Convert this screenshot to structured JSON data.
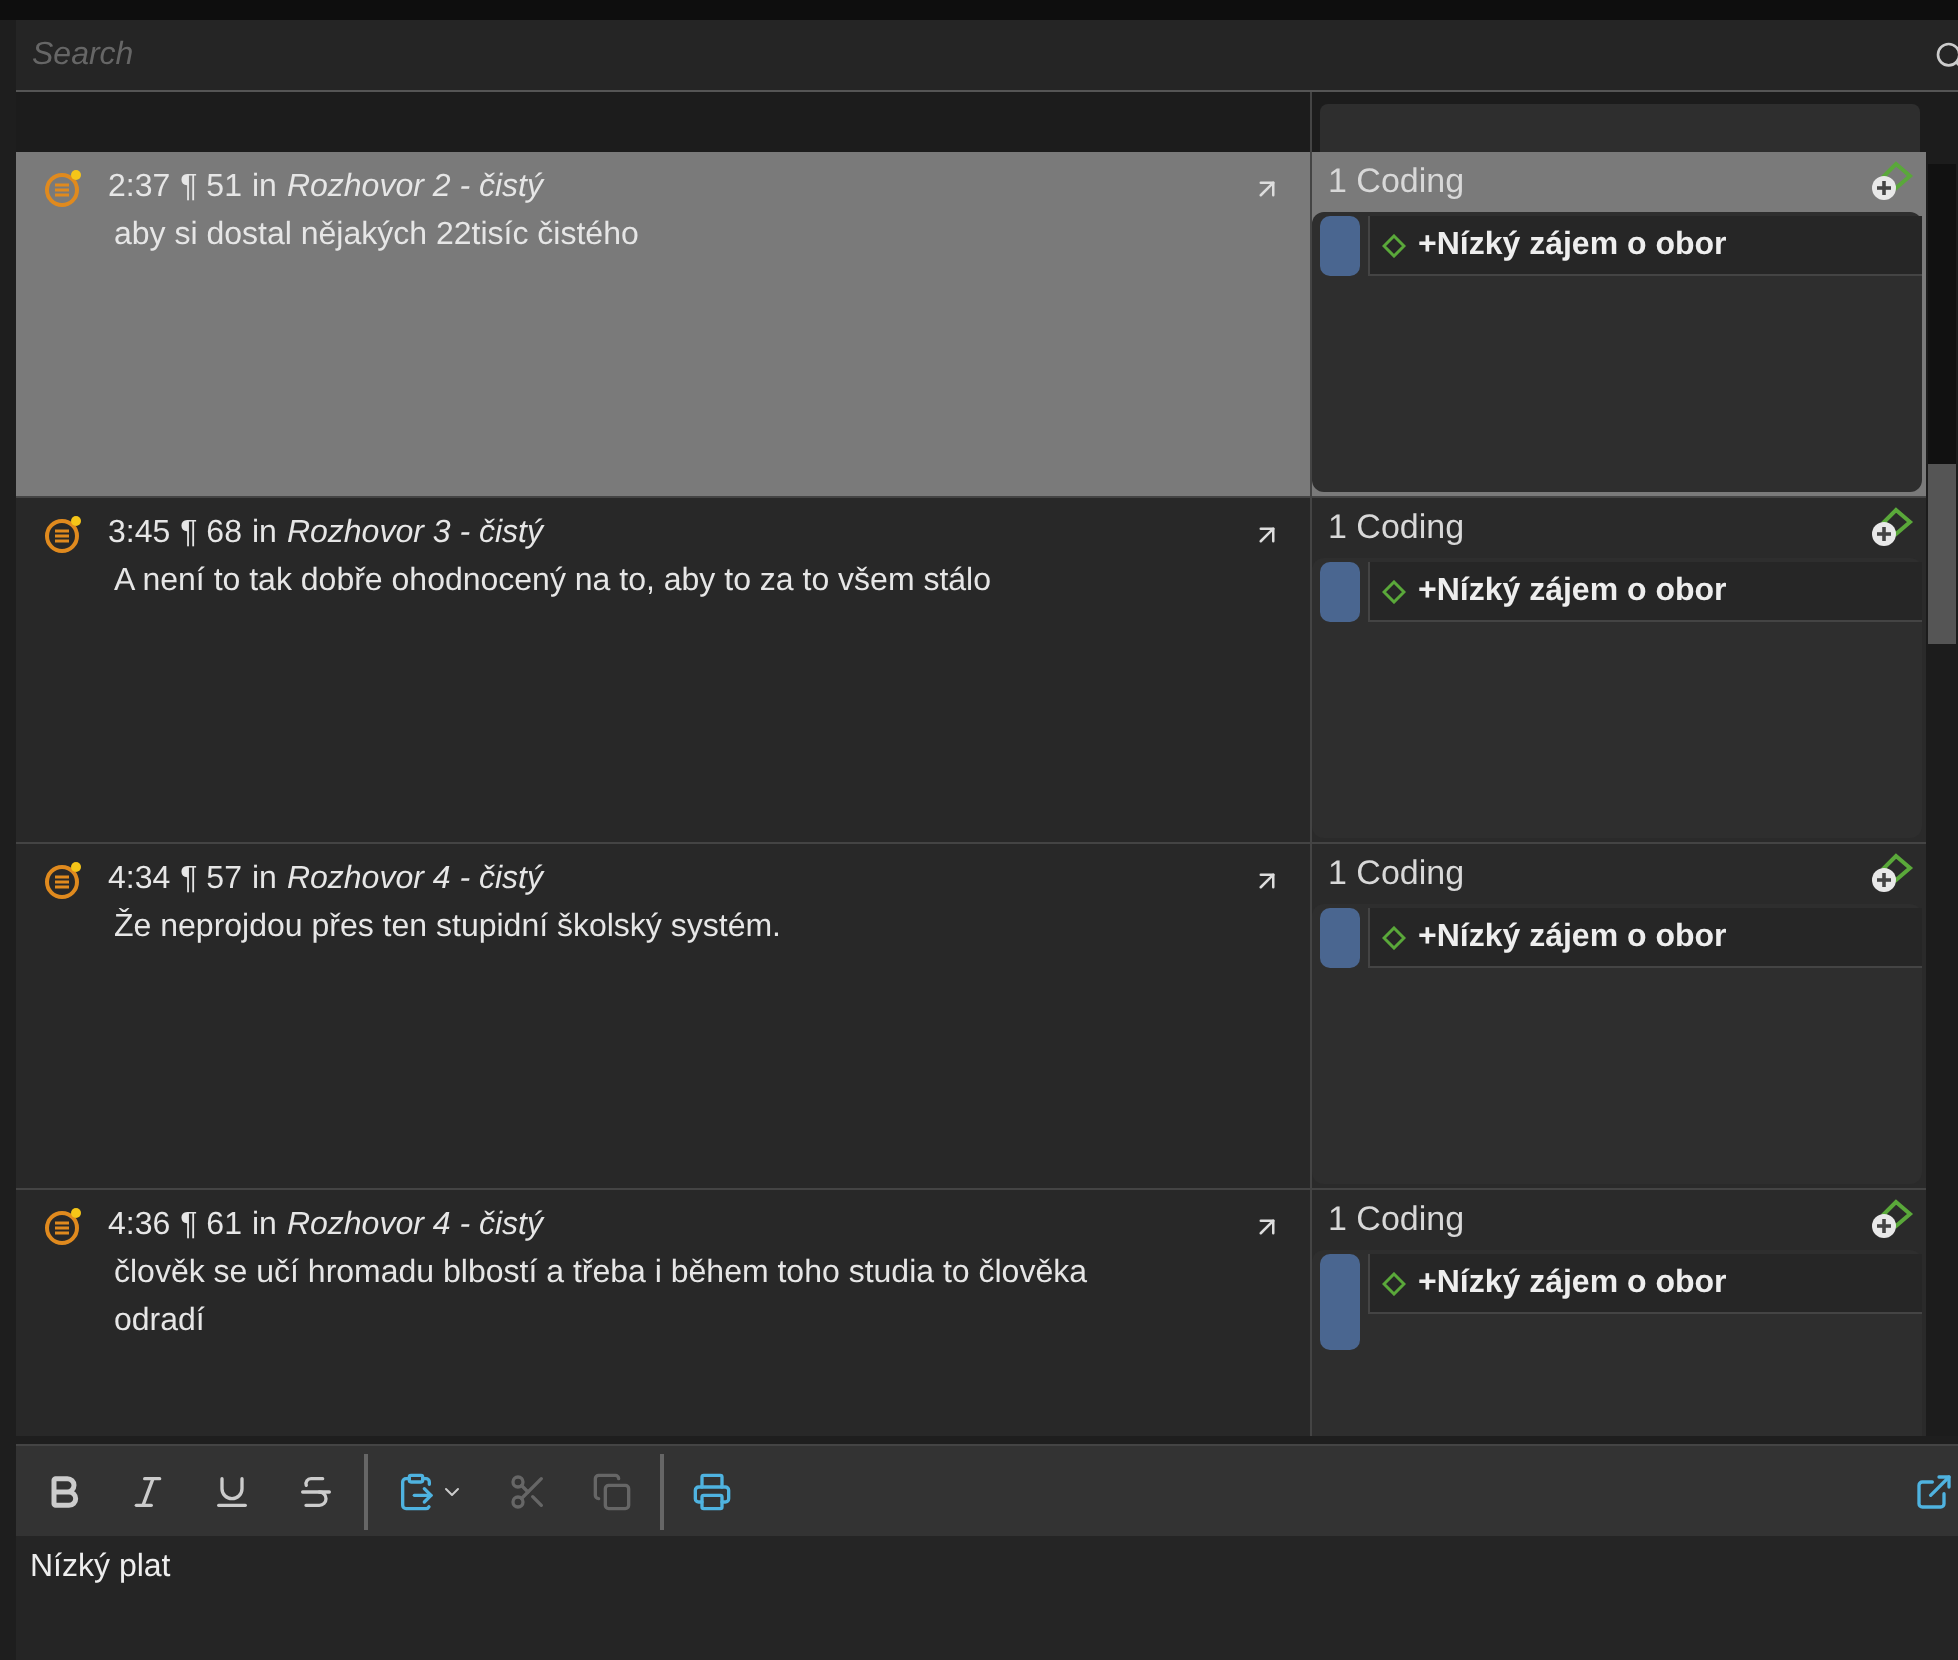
{
  "search": {
    "placeholder": "Search"
  },
  "quotations": [
    {
      "id": "2:37",
      "paragraph": "¶ 51",
      "in": "in",
      "document": "Rozhovor 2 - čistý",
      "text": "aby si dostal nějakých 22tisíc čistého",
      "selected": true,
      "coding_count": "1 Coding",
      "codes": [
        "+Nízký zájem o obor"
      ]
    },
    {
      "id": "3:45",
      "paragraph": "¶ 68",
      "in": "in",
      "document": "Rozhovor 3 - čistý",
      "text": "A není to tak dobře ohodnocený na to, aby to za to všem stálo",
      "selected": false,
      "coding_count": "1 Coding",
      "codes": [
        "+Nízký zájem o obor"
      ]
    },
    {
      "id": "4:34",
      "paragraph": "¶ 57",
      "in": "in",
      "document": "Rozhovor 4 - čistý",
      "text": "Že neprojdou přes ten stupidní školský systém.",
      "selected": false,
      "coding_count": "1 Coding",
      "codes": [
        "+Nízký zájem o obor"
      ]
    },
    {
      "id": "4:36",
      "paragraph": "¶ 61",
      "in": "in",
      "document": "Rozhovor 4 - čistý",
      "text": "člověk se učí hromadu blbostí a třeba i během toho studia to člověka odradí",
      "selected": false,
      "coding_count": "1 Coding",
      "codes": [
        "+Nízký zájem o obor"
      ]
    }
  ],
  "toolbar": [
    {
      "kind": "bold",
      "disabled": false
    },
    {
      "kind": "italic",
      "disabled": false
    },
    {
      "kind": "underline",
      "disabled": false
    },
    {
      "kind": "strike",
      "disabled": false
    },
    {
      "kind": "separator"
    },
    {
      "kind": "paste",
      "disabled": false
    },
    {
      "kind": "cut",
      "disabled": true
    },
    {
      "kind": "copy",
      "disabled": true
    },
    {
      "kind": "separator"
    },
    {
      "kind": "print",
      "disabled": false
    }
  ],
  "memo": {
    "text": "Nízký plat"
  }
}
